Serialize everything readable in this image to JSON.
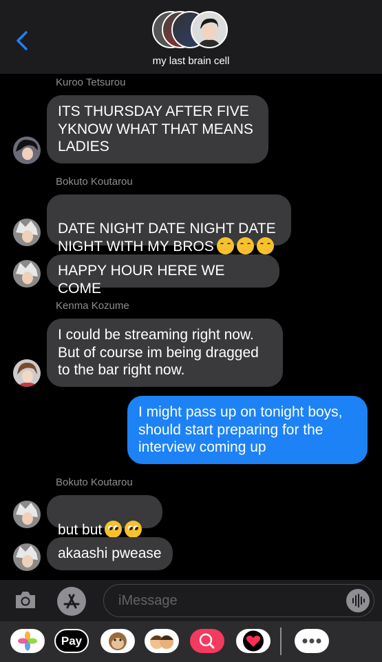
{
  "header": {
    "group_name": "my last brain cell"
  },
  "messages": [
    {
      "sender": "Kuroo Tetsurou",
      "text": "ITS THURSDAY AFTER FIVE\nYKNOW WHAT THAT MEANS\nLADIES"
    },
    {
      "sender": "Bokuto Koutarou",
      "text": "DATE NIGHT DATE NIGHT DATE\nNIGHT WITH MY BROS"
    },
    {
      "text": "HAPPY HOUR HERE WE COME"
    },
    {
      "sender": "Kenma Kozume",
      "text": "I could be streaming right now.\nBut of course im being dragged\nto the bar right now."
    },
    {
      "text": "I might pass up on tonight boys,\nshould start preparing for the\ninterview coming up"
    },
    {
      "sender": "Bokuto Koutarou",
      "text": "but but"
    },
    {
      "text": "akaashi pwease"
    }
  ],
  "input": {
    "placeholder": "iMessage"
  },
  "apps": {
    "pay_label": "Pay"
  }
}
